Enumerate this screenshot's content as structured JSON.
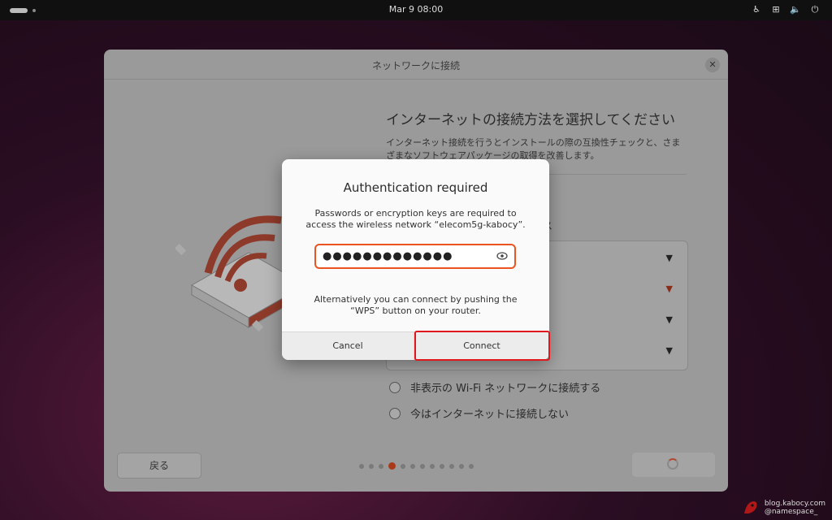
{
  "topbar": {
    "clock": "Mar 9  08:00"
  },
  "installer": {
    "title": "ネットワークに接続",
    "heading": "インターネットの接続方法を選択してください",
    "description": "インターネット接続を行うとインストールの際の互換性チェックと、さまざまなソフトウェアパッケージの取得を改善します。",
    "partial_label": "ス",
    "options": [
      {
        "label": "非表示の Wi-Fi ネットワークに接続する"
      },
      {
        "label": "今はインターネットに接続しない"
      }
    ],
    "back_label": "戻る",
    "page_total": 12,
    "page_current": 4
  },
  "dialog": {
    "title": "Authentication required",
    "message_line1": "Passwords or encryption keys are required to",
    "message_line2": "access the wireless network “elecom5g-kabocy”.",
    "password_value": "●●●●●●●●●●●●●",
    "wps_line1": "Alternatively you can connect by pushing the",
    "wps_line2": "“WPS” button on your router.",
    "cancel_label": "Cancel",
    "connect_label": "Connect"
  },
  "watermark": {
    "line1": "blog.kabocy.com",
    "line2": "@namespace_"
  },
  "colors": {
    "accent": "#e95420",
    "highlight": "#e0181c"
  }
}
